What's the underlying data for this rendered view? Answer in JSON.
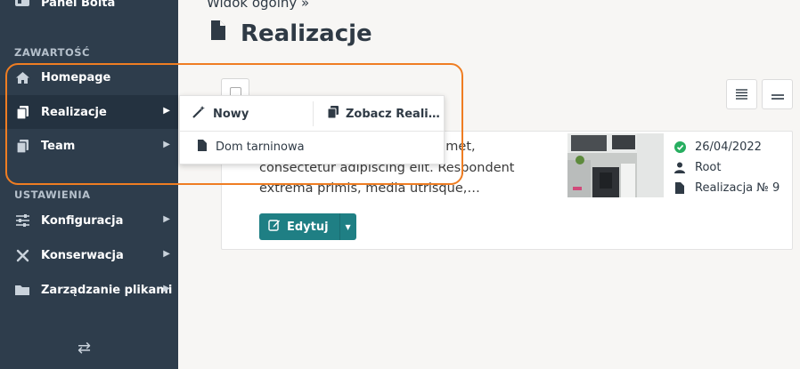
{
  "sidebar": {
    "brand": "Panel Bolta",
    "sections": {
      "content": "ZAWARTOŚĆ",
      "settings": "USTAWIENIA"
    },
    "items": [
      {
        "label": "Homepage",
        "icon": "home-icon"
      },
      {
        "label": "Realizacje",
        "icon": "copy-icon",
        "active": true
      },
      {
        "label": "Team",
        "icon": "copy-icon"
      },
      {
        "label": "Konfiguracja",
        "icon": "sliders-icon"
      },
      {
        "label": "Konserwacja",
        "icon": "tools-icon"
      },
      {
        "label": "Zarządzanie plikami",
        "icon": "folder-icon"
      }
    ]
  },
  "header": {
    "breadcrumb": "Widok ogólny »",
    "title": "Realizacje"
  },
  "popup": {
    "new_label": "Nowy",
    "view_all_label": "Zobacz Reali…",
    "records": [
      "Dom tarninowa"
    ]
  },
  "record": {
    "excerpt": "owej Lorem ipsum dolor sit amet, consectetur adipiscing elit. Respondent extrema primis, media utrisque,…",
    "date": "26/04/2022",
    "author": "Root",
    "id_label": "Realizacja № 9",
    "edit_label": "Edytuj"
  },
  "colors": {
    "sidebar_bg": "#2e3d4c",
    "accent": "#1f7f84",
    "highlight": "#ef7d22",
    "status_ok": "#27ae60"
  }
}
